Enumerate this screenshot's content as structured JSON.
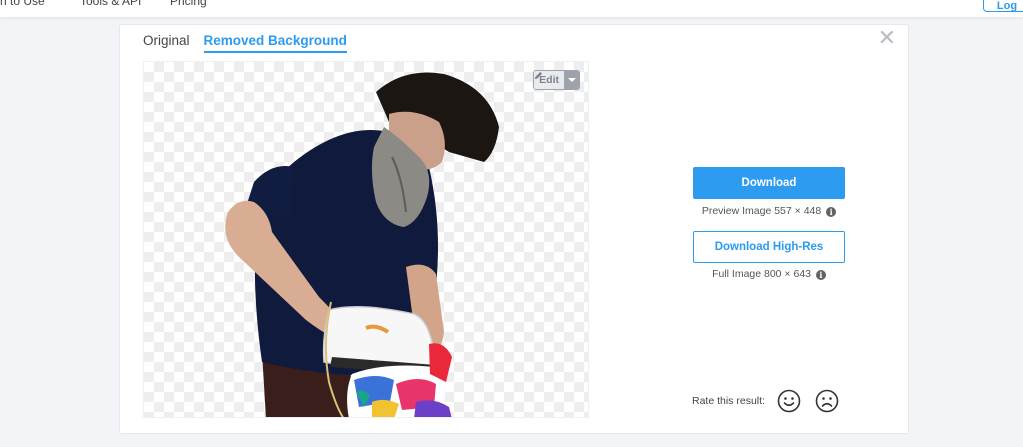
{
  "topbar": {
    "links": [
      "n to Use",
      "Tools & API",
      "Pricing"
    ],
    "right_button": "Log"
  },
  "tabs": {
    "original": "Original",
    "removed": "Removed Background"
  },
  "preview": {
    "edit_label": "Edit"
  },
  "download": {
    "label": "Download",
    "preview_info": "Preview Image 557 × 448"
  },
  "download_hr": {
    "label": "Download High-Res",
    "full_info": "Full Image 800 × 643"
  },
  "rating": {
    "label": "Rate this result:"
  },
  "icons": {
    "close": "close-icon",
    "pencil": "pencil-icon",
    "info": "info-icon",
    "happy": "smiley-icon",
    "sad": "frown-icon"
  },
  "colors": {
    "accent": "#2c9bf0",
    "background": "#f3f4f7"
  }
}
